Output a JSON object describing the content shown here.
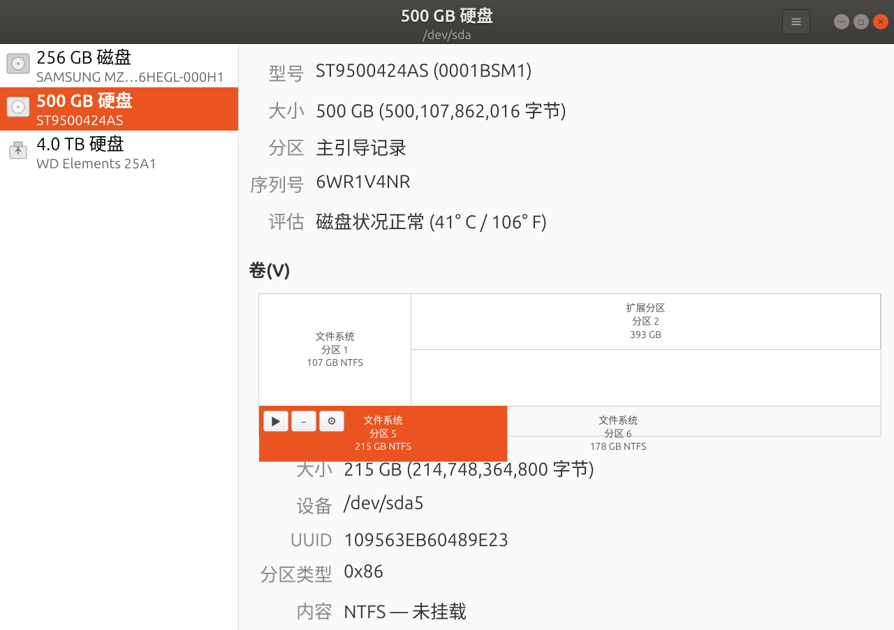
{
  "header": {
    "title": "500 GB 硬盘",
    "subtitle": "/dev/sda"
  },
  "sidebar": {
    "disks": [
      {
        "title": "256 GB 磁盘",
        "sub": "SAMSUNG MZ…6HEGL-000H1",
        "icon": "hdd"
      },
      {
        "title": "500 GB 硬盘",
        "sub": "ST9500424AS",
        "icon": "hdd"
      },
      {
        "title": "4.0 TB 硬盘",
        "sub": "WD Elements 25A1",
        "icon": "usb"
      }
    ],
    "selected_index": 1
  },
  "drive": {
    "labels": {
      "model": "型号",
      "size": "大小",
      "partitioning": "分区",
      "serial": "序列号",
      "assessment": "评估"
    },
    "model": "ST9500424AS (0001BSM1)",
    "size": "500 GB (500,107,862,016 字节)",
    "partitioning": "主引导记录",
    "serial": "6WR1V4NR",
    "assessment": "磁盘状况正常 (41° C / 106° F)"
  },
  "volumes_heading": "卷(V)",
  "partitions": {
    "p1": {
      "l1": "文件系统",
      "l2": "分区 1",
      "l3": "107 GB NTFS"
    },
    "p2": {
      "l1": "扩展分区",
      "l2": "分区 2",
      "l3": "393 GB"
    },
    "p5": {
      "l1": "文件系统",
      "l2": "分区 5",
      "l3": "215 GB NTFS"
    },
    "p6": {
      "l1": "文件系统",
      "l2": "分区 6",
      "l3": "178 GB NTFS"
    }
  },
  "volume": {
    "labels": {
      "size": "大小",
      "device": "设备",
      "uuid": "UUID",
      "ptype": "分区类型",
      "contents": "内容"
    },
    "size": "215 GB (214,748,364,800 字节)",
    "device": "/dev/sda5",
    "uuid": "109563EB60489E23",
    "ptype": "0x86",
    "contents": "NTFS — 未挂载"
  }
}
